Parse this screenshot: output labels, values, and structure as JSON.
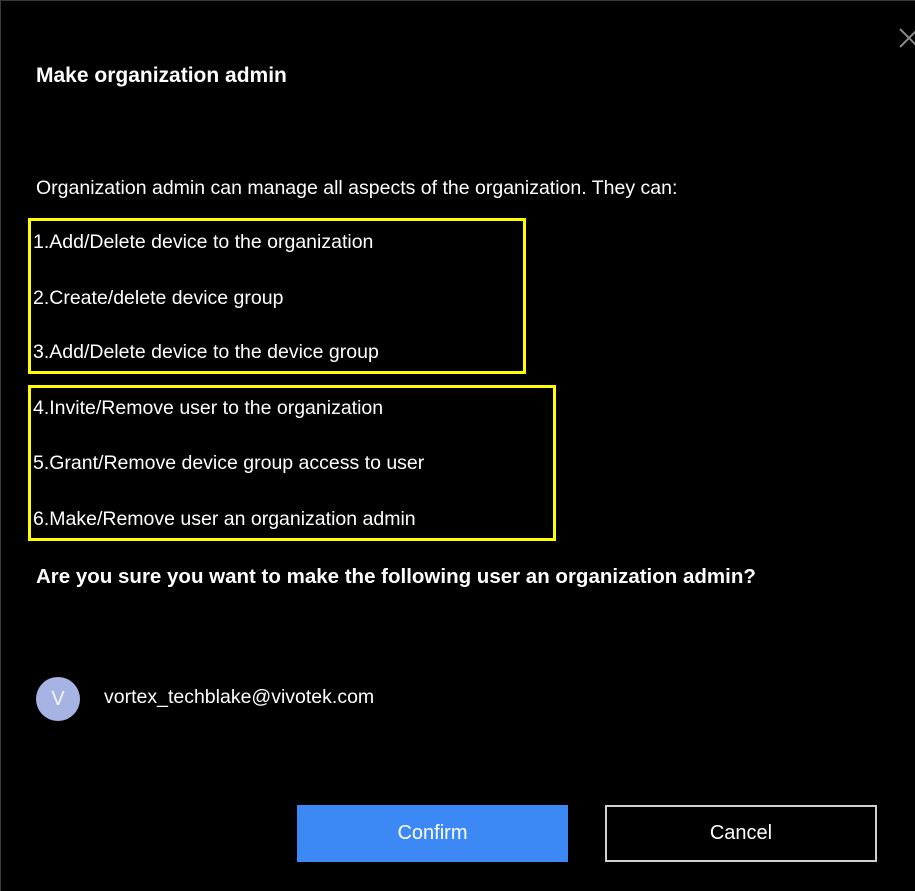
{
  "dialog": {
    "title": "Make organization admin",
    "intro": "Organization admin can manage all aspects of the organization. They can:",
    "permissions": [
      "1.Add/Delete device to the organization",
      "2.Create/delete device group",
      "3.Add/Delete device to the device group",
      "4.Invite/Remove user to the organization",
      "5.Grant/Remove device group access to user",
      "6.Make/Remove user an organization admin"
    ],
    "question": "Are you sure you want to make the following user an organization admin?",
    "user": {
      "avatar_initial": "V",
      "email": "vortex_techblake@vivotek.com"
    },
    "buttons": {
      "confirm": "Confirm",
      "cancel": "Cancel"
    }
  },
  "colors": {
    "background": "#000000",
    "highlight": "#ffff00",
    "primary_button": "#3c89f5",
    "avatar": "#a7b3e2"
  },
  "icons": {
    "close": "close-icon"
  }
}
